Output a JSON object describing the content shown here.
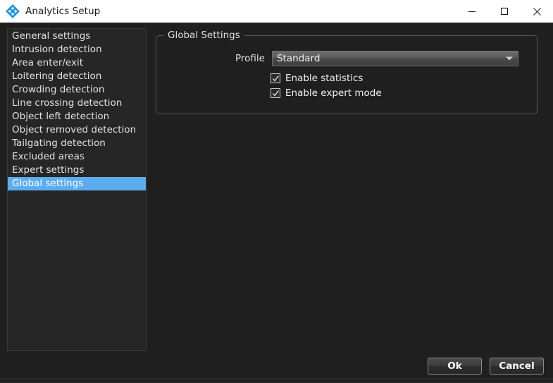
{
  "window": {
    "title": "Analytics Setup",
    "icon": "move-diamond-icon",
    "controls": {
      "minimize": "minimize-icon",
      "maximize": "maximize-icon",
      "close": "close-icon"
    }
  },
  "sidebar": {
    "items": [
      {
        "label": "General settings",
        "selected": false
      },
      {
        "label": "Intrusion detection",
        "selected": false
      },
      {
        "label": "Area enter/exit",
        "selected": false
      },
      {
        "label": "Loitering detection",
        "selected": false
      },
      {
        "label": "Crowding detection",
        "selected": false
      },
      {
        "label": "Line crossing detection",
        "selected": false
      },
      {
        "label": "Object left detection",
        "selected": false
      },
      {
        "label": "Object removed detection",
        "selected": false
      },
      {
        "label": "Tailgating detection",
        "selected": false
      },
      {
        "label": "Excluded areas",
        "selected": false
      },
      {
        "label": "Expert settings",
        "selected": false
      },
      {
        "label": "Global settings",
        "selected": true
      }
    ]
  },
  "main": {
    "group_title": "Global Settings",
    "profile": {
      "label": "Profile",
      "value": "Standard",
      "arrow_icon": "chevron-down-icon"
    },
    "checkboxes": [
      {
        "label": "Enable statistics",
        "checked": true
      },
      {
        "label": "Enable expert mode",
        "checked": true
      }
    ]
  },
  "footer": {
    "ok_label": "Ok",
    "cancel_label": "Cancel"
  },
  "colors": {
    "selection": "#5cacee",
    "titlebar_bg": "#ffffff",
    "window_bg": "#1f1f1f",
    "text": "#e2e2e2"
  }
}
